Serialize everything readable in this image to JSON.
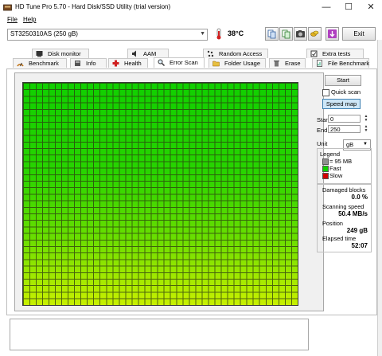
{
  "window": {
    "title": "HD Tune Pro 5.70 - Hard Disk/SSD Utility (trial version)",
    "minimize": "—",
    "maximize": "☐",
    "close": "✕"
  },
  "menu": {
    "file": "File",
    "help": "Help"
  },
  "toolbar": {
    "drive": "ST3250310AS (250 gB)",
    "temperature": "38°C",
    "exit_label": "Exit",
    "icons": [
      "copy-info-icon",
      "copy-icon",
      "screenshot-icon",
      "options-icon",
      "save-icon"
    ]
  },
  "tabs_top": [
    {
      "label": "Disk monitor",
      "icon": "disk-monitor-icon"
    },
    {
      "label": "AAM",
      "icon": "aam-icon"
    },
    {
      "label": "Random Access",
      "icon": "random-access-icon"
    },
    {
      "label": "Extra tests",
      "icon": "extra-tests-icon"
    }
  ],
  "tabs_bottom": [
    {
      "label": "Benchmark",
      "icon": "benchmark-icon"
    },
    {
      "label": "Info",
      "icon": "info-icon"
    },
    {
      "label": "Health",
      "icon": "health-icon"
    },
    {
      "label": "Error Scan",
      "icon": "error-scan-icon",
      "active": true
    },
    {
      "label": "Folder Usage",
      "icon": "folder-icon"
    },
    {
      "label": "Erase",
      "icon": "erase-icon"
    },
    {
      "label": "File Benchmark",
      "icon": "file-benchmark-icon"
    }
  ],
  "scan": {
    "start_label": "Start",
    "quick_scan_label": "Quick scan",
    "quick_scan_checked": false,
    "speed_map_label": "Speed map",
    "start_field_label": "Start",
    "start_value": "0",
    "end_field_label": "End",
    "end_value": "250",
    "unit_label": "Unit",
    "unit_value": "gB",
    "colors": {
      "fast": "#10d000",
      "slow": "#d00000",
      "grid_top": "#10d000",
      "grid_bottom": "#c8f000"
    }
  },
  "legend": {
    "title": "Legend",
    "block_size": "= 95 MB",
    "fast": "Fast",
    "slow": "Slow"
  },
  "stats": {
    "damaged_label": "Damaged blocks",
    "damaged_value": "0.0 %",
    "speed_label": "Scanning speed",
    "speed_value": "50.4 MB/s",
    "position_label": "Position",
    "position_value": "249 gB",
    "elapsed_label": "Elapsed time",
    "elapsed_value": "52:07"
  }
}
